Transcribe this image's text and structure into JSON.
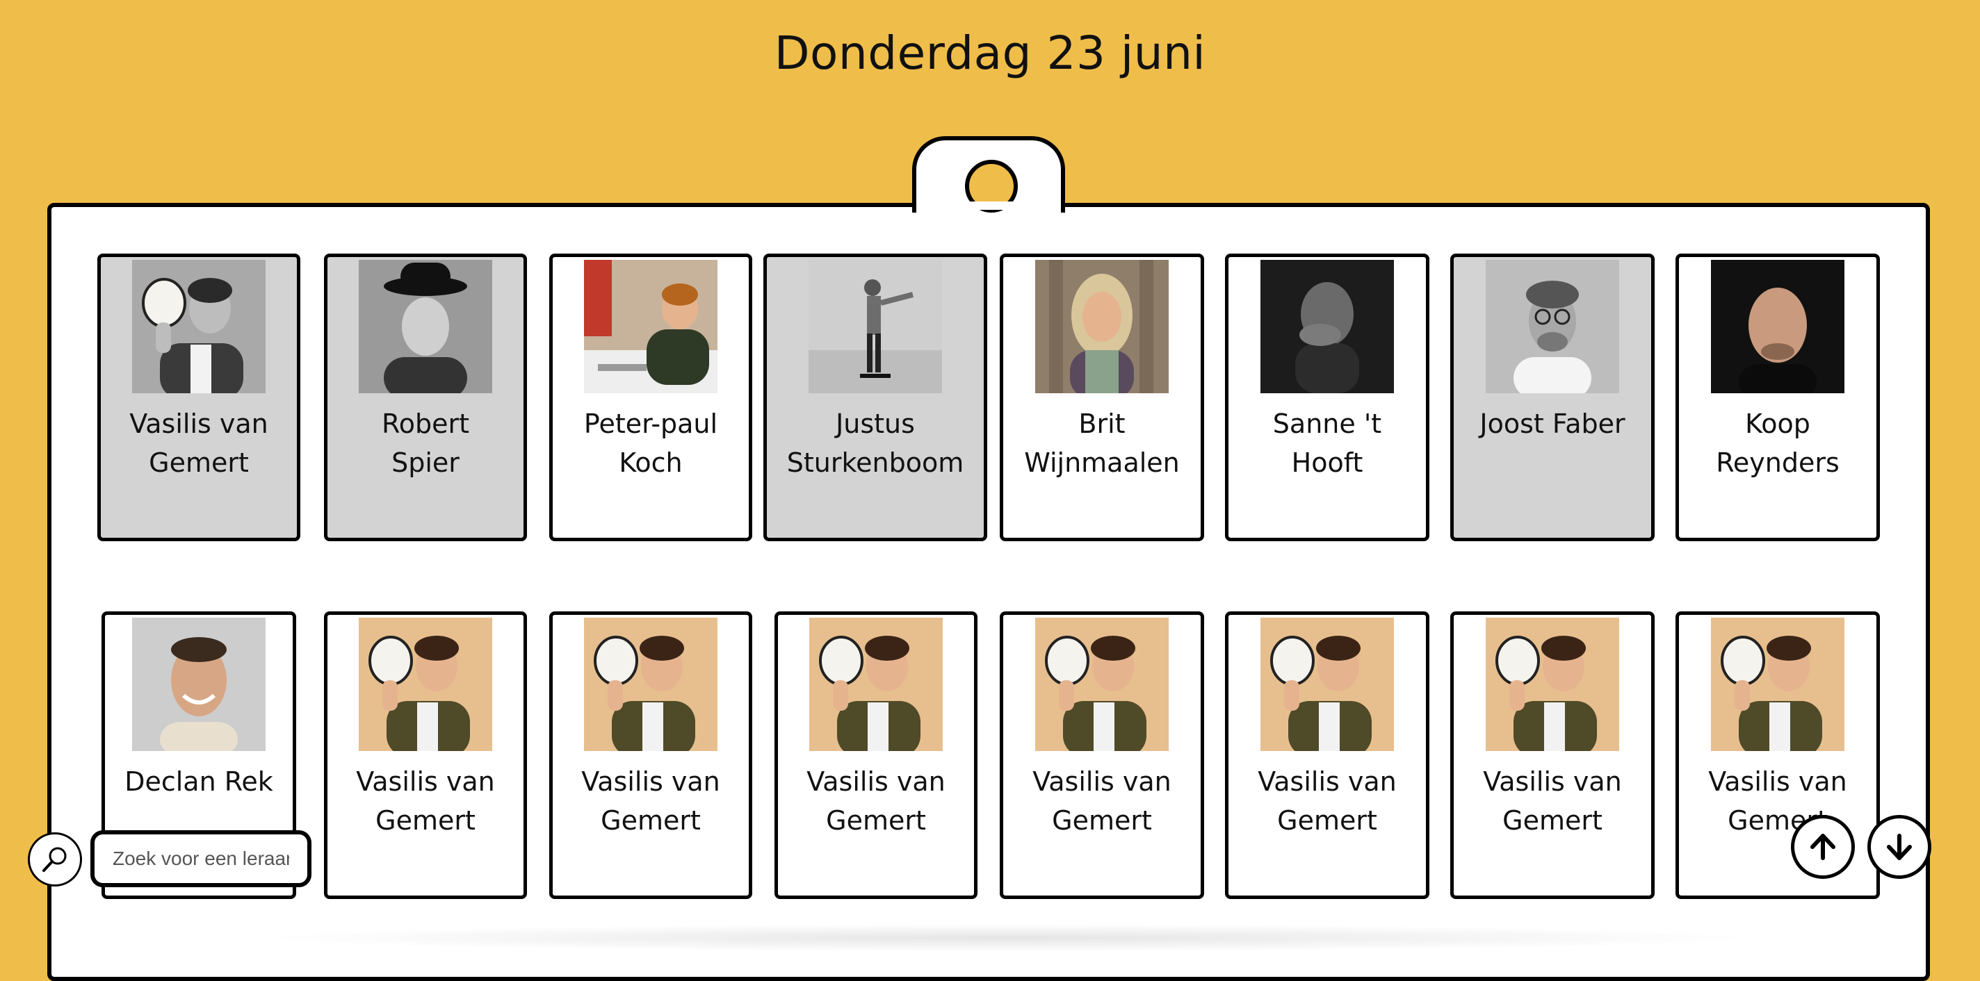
{
  "page": {
    "title": "Donderdag 23 juni"
  },
  "teachers": [
    {
      "first": "Vasilis van",
      "last": "Gemert",
      "photo": "man-holding-hat-photo",
      "bw": true
    },
    {
      "first": "Robert",
      "last": "Spier",
      "photo": "man-with-black-hat-photo",
      "bw": true
    },
    {
      "first": "Peter-paul",
      "last": "Koch",
      "photo": "man-at-desk-photo",
      "bw": false
    },
    {
      "first": "Justus",
      "last": "Sturkenboom",
      "photo": "man-skateboarding-photo",
      "bw": true
    },
    {
      "first": "Brit",
      "last": "Wijnmaalen",
      "photo": "woman-smiling-photo",
      "bw": false
    },
    {
      "first": "Sanne 't",
      "last": "Hooft",
      "photo": "man-hand-on-face-photo",
      "bw": true
    },
    {
      "first": "Joost Faber",
      "last": "",
      "photo": "man-with-glasses-photo",
      "bw": true
    },
    {
      "first": "Koop",
      "last": "Reynders",
      "photo": "bald-man-dark-photo",
      "bw": false
    },
    {
      "first": "Declan Rek",
      "last": "",
      "photo": "smiling-man-photo",
      "bw": false
    },
    {
      "first": "Vasilis van",
      "last": "Gemert",
      "photo": "man-holding-hat-photo",
      "bw": false
    },
    {
      "first": "Vasilis van",
      "last": "Gemert",
      "photo": "man-holding-hat-photo",
      "bw": false
    },
    {
      "first": "Vasilis van",
      "last": "Gemert",
      "photo": "man-holding-hat-photo",
      "bw": false
    },
    {
      "first": "Vasilis van",
      "last": "Gemert",
      "photo": "man-holding-hat-photo",
      "bw": false
    },
    {
      "first": "Vasilis van",
      "last": "Gemert",
      "photo": "man-holding-hat-photo",
      "bw": false
    },
    {
      "first": "Vasilis van",
      "last": "Gemert",
      "photo": "man-holding-hat-photo",
      "bw": false
    },
    {
      "first": "Vasilis van",
      "last": "Gemert",
      "photo": "man-holding-hat-photo",
      "bw": false
    }
  ],
  "search": {
    "placeholder": "Zoek voor een leraar",
    "icon": "search-icon"
  },
  "controls": {
    "up_icon": "arrow-up-icon",
    "down_icon": "arrow-down-icon"
  },
  "colors": {
    "background": "#efbd4a",
    "card_grey": "#d3d3d3",
    "border": "#000000"
  }
}
